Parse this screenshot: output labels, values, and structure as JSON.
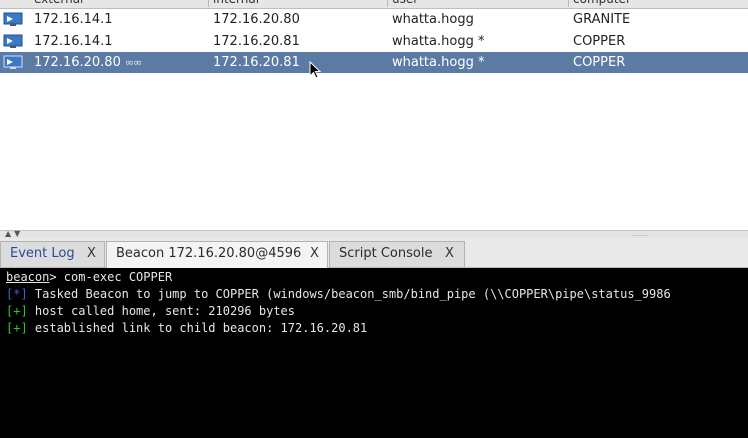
{
  "table": {
    "columns": [
      "external",
      "internal",
      "user",
      "computer"
    ],
    "rows": [
      {
        "external": "172.16.14.1",
        "internal": "172.16.20.80",
        "user": "whatta.hogg",
        "computer": "GRANITE",
        "selected": false,
        "icon": "beacon-icon"
      },
      {
        "external": "172.16.14.1",
        "internal": "172.16.20.81",
        "user": "whatta.hogg *",
        "computer": "COPPER",
        "selected": false,
        "icon": "beacon-icon"
      },
      {
        "external": "172.16.20.80",
        "link_indicator": "∞∞",
        "internal": "172.16.20.81",
        "user": "whatta.hogg *",
        "computer": "COPPER",
        "selected": true,
        "icon": "beacon-icon"
      }
    ]
  },
  "tabs": [
    {
      "label": "Event Log",
      "close": "X",
      "active": false
    },
    {
      "label": "Beacon 172.16.20.80@4596",
      "close": "X",
      "active": true
    },
    {
      "label": "Script Console",
      "close": "X",
      "active": false
    }
  ],
  "console": {
    "prompt": "beacon",
    "command": "> com-exec COPPER",
    "lines": [
      {
        "tag": "[*]",
        "text": " Tasked Beacon to jump to COPPER (windows/beacon_smb/bind_pipe (\\\\COPPER\\pipe\\status_9986"
      },
      {
        "tag": "[+]",
        "text": " host called home, sent: 210296 bytes"
      },
      {
        "tag": "[+]",
        "text": " established link to child beacon: 172.16.20.81"
      }
    ]
  },
  "colors": {
    "selection": "#5b7ba4",
    "console_bg": "#000000",
    "info_tag": "#3b62d8",
    "success_tag": "#35c335"
  }
}
